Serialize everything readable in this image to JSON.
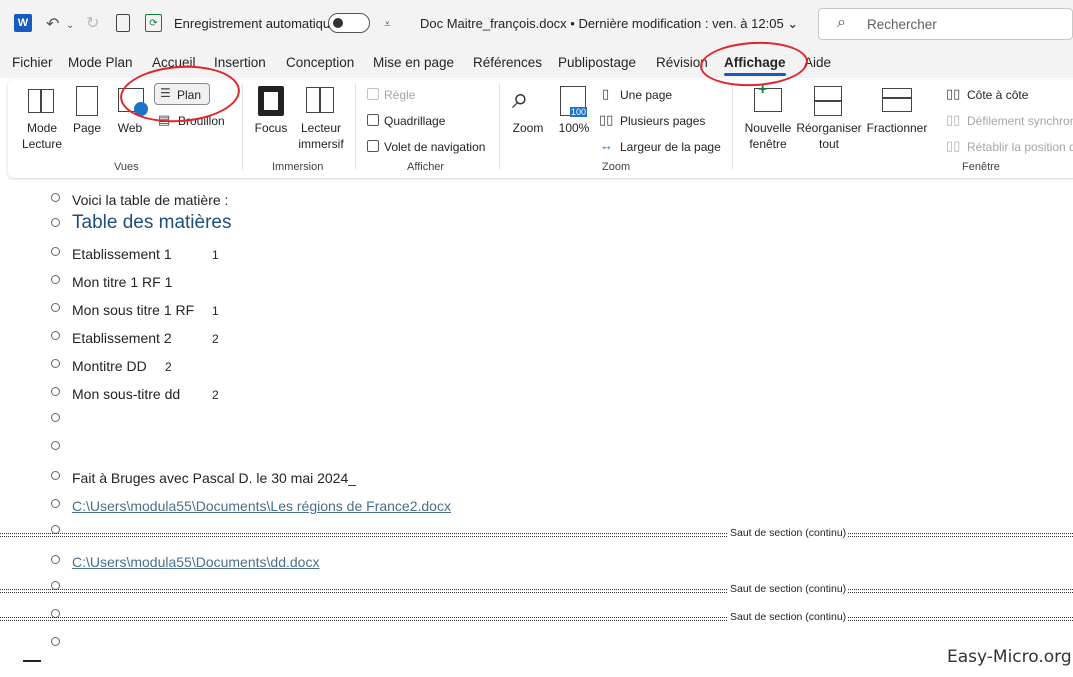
{
  "titlebar": {
    "app_logo": "W",
    "autosave_label": "Enregistrement automatique",
    "autosave_on": false,
    "doc_title": "Doc Maitre_françois.docx  •  Dernière modification : ven. à 12:05 ⌄",
    "search_placeholder": "Rechercher"
  },
  "menu": {
    "tabs": [
      "Fichier",
      "Mode Plan",
      "Accueil",
      "Insertion",
      "Conception",
      "Mise en page",
      "Références",
      "Publipostage",
      "Révision",
      "Affichage",
      "Aide"
    ],
    "active": "Affichage"
  },
  "ribbon": {
    "vues": {
      "mode_lecture": "Mode\nLecture",
      "mode_lecture_1": "Mode",
      "mode_lecture_2": "Lecture",
      "page": "Page",
      "web": "Web",
      "plan": "Plan",
      "brouillon": "Brouillon",
      "label": "Vues"
    },
    "immersion": {
      "focus": "Focus",
      "lecteur_1": "Lecteur",
      "lecteur_2": "immersif",
      "label": "Immersion"
    },
    "afficher": {
      "regle": "Règle",
      "quadrillage": "Quadrillage",
      "volet": "Volet de navigation",
      "label": "Afficher"
    },
    "zoom": {
      "zoom": "Zoom",
      "pct": "100%",
      "pct_icon": "100",
      "une_page": "Une page",
      "plusieurs": "Plusieurs pages",
      "largeur": "Largeur de la page",
      "label": "Zoom"
    },
    "fenetre": {
      "nouvelle_1": "Nouvelle",
      "nouvelle_2": "fenêtre",
      "reorg_1": "Réorganiser",
      "reorg_2": "tout",
      "fractionner": "Fractionner",
      "cote": "Côte à côte",
      "defilement": "Défilement synchron",
      "retablir": "Rétablir la position d",
      "label": "Fenêtre"
    }
  },
  "document": {
    "lines": [
      {
        "text": "Voici la table de matière :"
      },
      {
        "text": "Table des matières"
      },
      {
        "text": "Etablissement 1",
        "page": "1"
      },
      {
        "text": "Mon titre 1 RF 1"
      },
      {
        "text": "Mon sous titre 1 RF",
        "page": "1"
      },
      {
        "text": "Etablissement 2",
        "page": "2"
      },
      {
        "text": "Montitre DD",
        "page": "2"
      },
      {
        "text": "Mon sous-titre dd",
        "page": "2"
      },
      {
        "text": ""
      },
      {
        "text": ""
      },
      {
        "text": "Fait à Bruges avec Pascal D. le 30 mai 2024_"
      },
      {
        "text": "C:\\Users\\modula55\\Documents\\Les régions de France2.docx"
      },
      {
        "text": ""
      },
      {
        "text": "C:\\Users\\modula55\\Documents\\dd.docx"
      }
    ],
    "section_break": "Saut de section (continu)"
  },
  "watermark": "Easy-Micro.org",
  "colors": {
    "accent": "#185abd",
    "highlight_ellipse": "#e0252b",
    "heading": "#1f4e79",
    "link": "#4a6f8a"
  }
}
